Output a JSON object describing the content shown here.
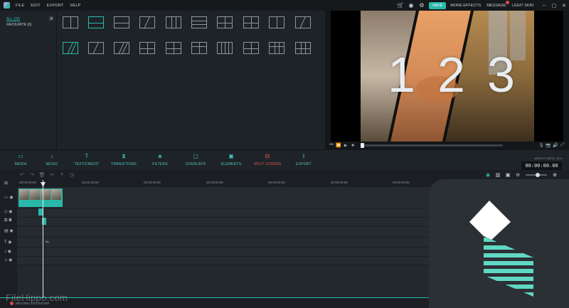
{
  "menubar": {
    "items": [
      "FILE",
      "EDIT",
      "EXPORT",
      "HELP"
    ],
    "save_label": "SAVE",
    "more_effects": "MORE EFFECTS",
    "message": "MESSAGE",
    "light_skin": "LIGHT SKIN",
    "icons": [
      "cart-icon",
      "account-icon",
      "settings-icon"
    ]
  },
  "library": {
    "all_label": "ALL (28)",
    "favourite_label": "FAVOURITE (0)"
  },
  "preview": {
    "numbers": [
      "1",
      "2",
      "3"
    ],
    "progress": 0.0
  },
  "tabs": [
    {
      "label": "MEDIA",
      "icon": "folder-icon"
    },
    {
      "label": "MUSIC",
      "icon": "music-note-icon"
    },
    {
      "label": "TEXT/CREDIT",
      "icon": "text-icon"
    },
    {
      "label": "TRANSITIONS",
      "icon": "transition-icon"
    },
    {
      "label": "FILTERS",
      "icon": "filter-icon"
    },
    {
      "label": "OVERLAYS",
      "icon": "overlay-icon"
    },
    {
      "label": "ELEMENTS",
      "icon": "image-icon"
    },
    {
      "label": "SPLIT SCREEN",
      "icon": "split-screen-icon",
      "active": true
    },
    {
      "label": "EXPORT",
      "icon": "export-icon"
    }
  ],
  "aspect": {
    "label": "ASPECT RATIO: 16:9",
    "timecode": "00:00:00.00"
  },
  "ruler": [
    "00:00:00:00",
    "00:01:00:00",
    "00:02:00:00",
    "00:03:00:00",
    "00:04:00:00",
    "00:05:00:00",
    "00:06:00:00"
  ],
  "bottom": {
    "record_label": "RECORD VOICEOVER"
  },
  "watermark": "FileHippo.com",
  "colors": {
    "accent": "#2ab8aa",
    "active_tab": "#e25555"
  }
}
